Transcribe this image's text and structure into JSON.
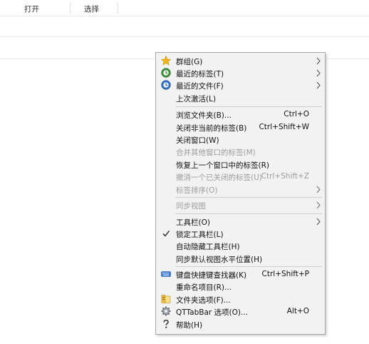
{
  "ribbon": {
    "tab_open": "打开",
    "tab_select": "选择"
  },
  "menu": {
    "items": [
      {
        "label": "群组(G)"
      },
      {
        "label": "最近的标签(T)"
      },
      {
        "label": "最近的文件(F)"
      },
      {
        "label": "上次激活(L)"
      },
      {
        "label": "浏览文件夹(B)...",
        "shortcut": "Ctrl+O"
      },
      {
        "label": "关闭非当前的标签(B)",
        "shortcut": "Ctrl+Shift+W"
      },
      {
        "label": "关闭窗口(W)"
      },
      {
        "label": "合并其他窗口的标签(M)"
      },
      {
        "label": "恢复上一个窗口中的标签(R)"
      },
      {
        "label": "撤消一个已关闭的标签(U)",
        "shortcut": "Ctrl+Shift+Z"
      },
      {
        "label": "标签排序(O)"
      },
      {
        "label": "同步视图"
      },
      {
        "label": "工具栏(O)"
      },
      {
        "label": "锁定工具栏(L)",
        "checked": true
      },
      {
        "label": "自动隐藏工具栏(H)"
      },
      {
        "label": "同步默认视图水平位置(H)"
      },
      {
        "label": "键盘快捷键查找器(K)",
        "shortcut": "Ctrl+Shift+P"
      },
      {
        "label": "重命名项目(R)..."
      },
      {
        "label": "文件夹选项(F)..."
      },
      {
        "label": "QTTabBar 选项(O)...",
        "shortcut": "Alt+O"
      },
      {
        "label": "帮助(H)"
      }
    ]
  }
}
